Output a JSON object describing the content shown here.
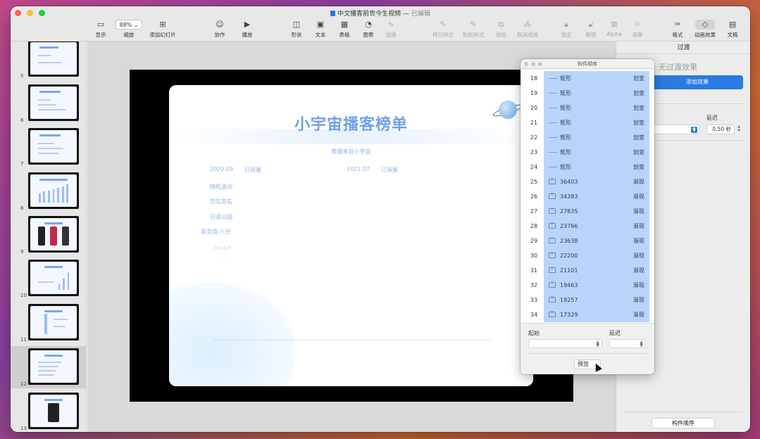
{
  "window": {
    "title": "中文播客前世今生视频",
    "separator": "—",
    "status": "已编辑"
  },
  "toolbar": {
    "view_label": "显示",
    "zoom_value": "88%",
    "zoom_label": "缩放",
    "add_slide_label": "添加幻灯片",
    "collaborate_label": "协作",
    "play_label": "播放",
    "shape_label": "形状",
    "text_label": "文本",
    "table_label": "表格",
    "chart_label": "图表",
    "connect_label": "连接",
    "copy_style_label": "拷贝样式",
    "paste_style_label": "粘贴样式",
    "group_label": "成组",
    "ungroup_label": "取消成组",
    "lock_label": "锁定",
    "unlock_label": "解锁",
    "alpha_label": "Alpha",
    "mask_label": "遮罩",
    "format_label": "格式",
    "animate_label": "动画效果",
    "document_label": "文稿"
  },
  "navigator": {
    "slides": [
      {
        "number": "5"
      },
      {
        "number": "6"
      },
      {
        "number": "7"
      },
      {
        "number": "8"
      },
      {
        "number": "9"
      },
      {
        "number": "10"
      },
      {
        "number": "11"
      },
      {
        "number": "12"
      },
      {
        "number": "13"
      }
    ]
  },
  "slide": {
    "title": "小宇宙播客榜单",
    "subtitle": "数据来自小宇宙",
    "date_left": "2020.09",
    "label_left": "订阅量",
    "date_right": "2022.07",
    "label_right": "订阅量",
    "list": [
      "随机波动",
      "忽左忽右",
      "日谈公园",
      "英文道·八分"
    ],
    "faint_1": "声东击西",
    "faint_2": "……"
  },
  "build_order": {
    "title": "构件顺序",
    "rows": [
      {
        "num": "18",
        "kind": "shape",
        "name": "矩形",
        "effect": "划变"
      },
      {
        "num": "19",
        "kind": "shape",
        "name": "矩形",
        "effect": "划变"
      },
      {
        "num": "20",
        "kind": "shape",
        "name": "矩形",
        "effect": "划变"
      },
      {
        "num": "21",
        "kind": "shape",
        "name": "矩形",
        "effect": "划变"
      },
      {
        "num": "22",
        "kind": "shape",
        "name": "矩形",
        "effect": "划变"
      },
      {
        "num": "23",
        "kind": "shape",
        "name": "矩形",
        "effect": "划变"
      },
      {
        "num": "24",
        "kind": "shape",
        "name": "矩形",
        "effect": "划变"
      },
      {
        "num": "25",
        "kind": "text",
        "name": "36403",
        "effect": "渐现"
      },
      {
        "num": "26",
        "kind": "text",
        "name": "34393",
        "effect": "渐现"
      },
      {
        "num": "27",
        "kind": "text",
        "name": "27835",
        "effect": "渐现"
      },
      {
        "num": "28",
        "kind": "text",
        "name": "23766",
        "effect": "渐现"
      },
      {
        "num": "29",
        "kind": "text",
        "name": "23638",
        "effect": "渐现"
      },
      {
        "num": "30",
        "kind": "text",
        "name": "22200",
        "effect": "渐现"
      },
      {
        "num": "31",
        "kind": "text",
        "name": "21101",
        "effect": "渐现"
      },
      {
        "num": "32",
        "kind": "text",
        "name": "19463",
        "effect": "渐现"
      },
      {
        "num": "33",
        "kind": "text",
        "name": "19257",
        "effect": "渐现"
      },
      {
        "num": "34",
        "kind": "text",
        "name": "17329",
        "effect": "渐现"
      }
    ],
    "start_label": "起始",
    "delay_label": "延迟",
    "preview_label": "预览"
  },
  "inspector": {
    "tab_label": "过渡",
    "no_effect": "无过渡效果",
    "add_effect": "添加效果",
    "delay_label": "延迟",
    "delay_value": "0.50 秒",
    "build_order_button": "构件顺序"
  },
  "colors": {
    "accent": "#2a7ae2",
    "selection": "#b9d4fb",
    "slide_title": "#6fa0e4"
  }
}
